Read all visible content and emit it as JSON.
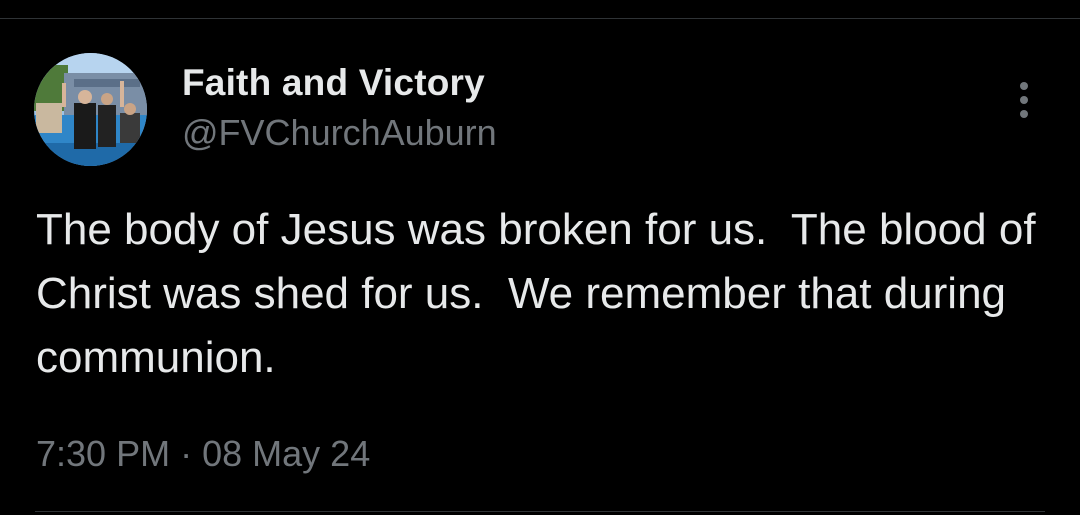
{
  "tweet": {
    "author": {
      "display_name": "Faith and Victory",
      "handle": "@FVChurchAuburn",
      "avatar_icon": "church-baptism-photo-avatar"
    },
    "text": "The body of Jesus was broken for us.  The blood of Christ was shed for us.  We remember that during communion.",
    "time": "7:30 PM",
    "separator": "·",
    "date": "08 May 24"
  },
  "icons": {
    "more": "vertical-ellipsis-icon"
  },
  "colors": {
    "background": "#000000",
    "primary_text": "#e7e9ea",
    "secondary_text": "#71767b",
    "divider": "#2f3336"
  }
}
